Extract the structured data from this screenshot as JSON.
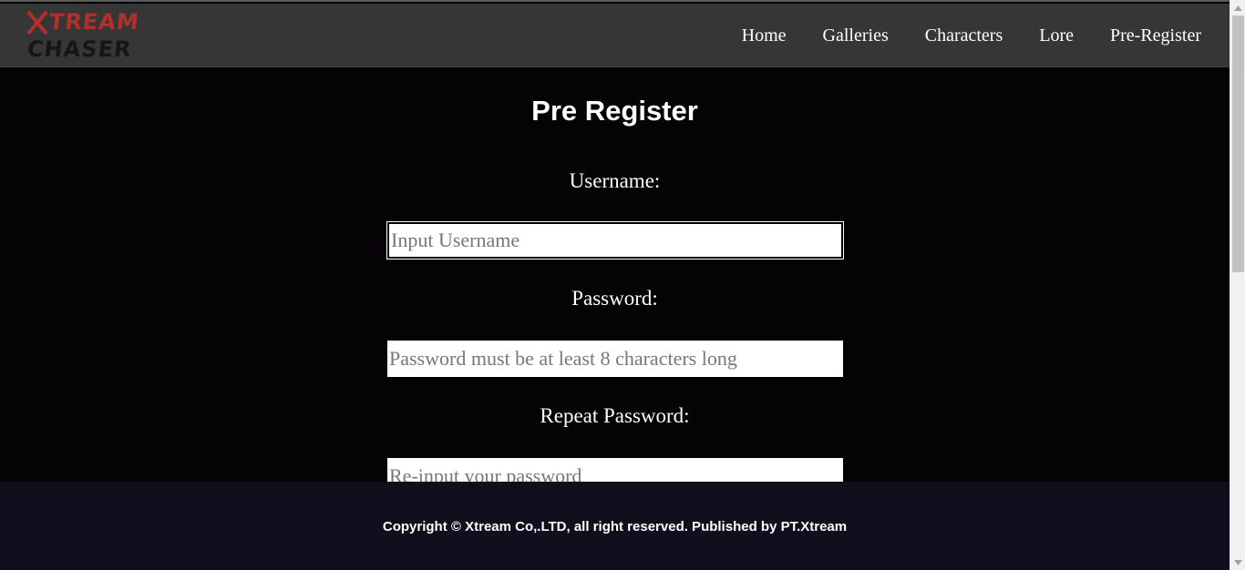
{
  "header": {
    "logo_line1": "TREAM",
    "logo_line2": "CHASER",
    "nav": [
      {
        "label": "Home"
      },
      {
        "label": "Galleries"
      },
      {
        "label": "Characters"
      },
      {
        "label": "Lore"
      },
      {
        "label": "Pre-Register"
      }
    ]
  },
  "main": {
    "title": "Pre Register",
    "fields": [
      {
        "label": "Username:",
        "placeholder": "Input Username"
      },
      {
        "label": "Password:",
        "placeholder": "Password must be at least 8 characters long"
      },
      {
        "label": "Repeat Password:",
        "placeholder": "Re-input your password"
      }
    ]
  },
  "footer": {
    "text": "Copyright © Xtream Co,.LTD, all right reserved. Published by PT.Xtream"
  },
  "colors": {
    "navbar_bg": "#363636",
    "main_bg": "#050306",
    "footer_bg": "#100f1d",
    "logo_red": "#b3302a",
    "logo_dark": "#161616"
  }
}
